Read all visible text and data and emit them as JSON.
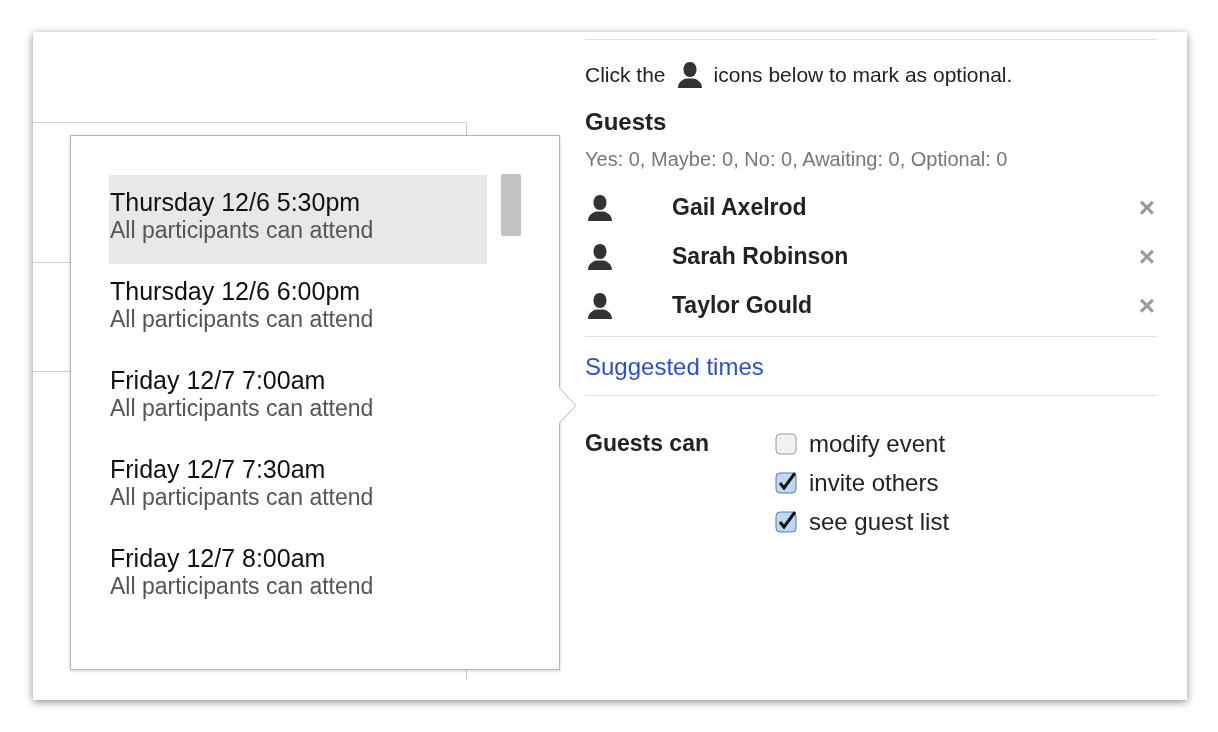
{
  "suggested_times_popup": {
    "slots": [
      {
        "time": "Thursday 12/6 5:30pm",
        "note": "All participants can attend",
        "selected": true
      },
      {
        "time": "Thursday 12/6 6:00pm",
        "note": "All participants can attend",
        "selected": false
      },
      {
        "time": "Friday 12/7 7:00am",
        "note": "All participants can attend",
        "selected": false
      },
      {
        "time": "Friday 12/7 7:30am",
        "note": "All participants can attend",
        "selected": false
      },
      {
        "time": "Friday 12/7 8:00am",
        "note": "All participants can attend",
        "selected": false
      }
    ]
  },
  "hint": {
    "before": "Click the",
    "after": "icons below to mark as optional."
  },
  "guests": {
    "title": "Guests",
    "summary": "Yes: 0, Maybe: 0, No: 0, Awaiting: 0, Optional: 0",
    "list": [
      {
        "name": "Gail Axelrod",
        "remove": "×"
      },
      {
        "name": "Sarah Robinson",
        "remove": "×"
      },
      {
        "name": "Taylor Gould",
        "remove": "×"
      }
    ]
  },
  "suggested_times_link": "Suggested times",
  "permissions": {
    "label": "Guests can",
    "options": [
      {
        "label": "modify event",
        "checked": false
      },
      {
        "label": "invite others",
        "checked": true
      },
      {
        "label": "see guest list",
        "checked": true
      }
    ]
  }
}
